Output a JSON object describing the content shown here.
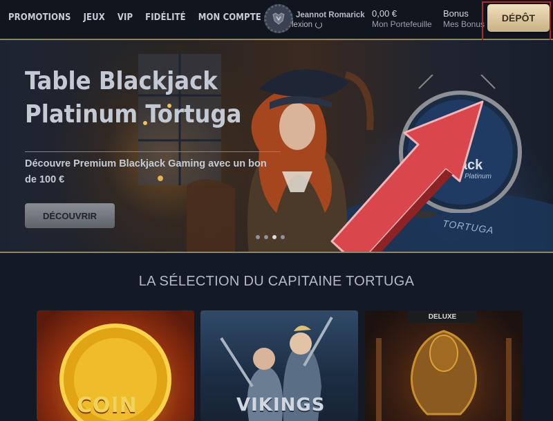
{
  "nav": {
    "items": [
      "PROMOTIONS",
      "JEUX",
      "VIP",
      "FIDÉLITÉ",
      "MON COMPTE"
    ]
  },
  "user": {
    "name": "Jeannot Romarick",
    "logout_label": "lexion",
    "avatar_icon": "crest-icon",
    "logout_icon": "power-icon"
  },
  "wallet": {
    "amount": "0,00 €",
    "label": "Mon Portefeuille"
  },
  "bonus": {
    "title": "Bonus",
    "label": "Mes Bonus"
  },
  "deposit": {
    "label": "DÉPÔT"
  },
  "hero": {
    "title": "Table Blackjack Platinum Tortuga",
    "subtitle": "Découvre Premium Blackjack Gaming avec un bon de 100 €",
    "cta": "DÉCOUVRIR",
    "badge_title": "Blackjack",
    "badge_sub": "Platinum",
    "table_text": "TORTUGA",
    "slides_total": 4,
    "active_slide": 2
  },
  "selection": {
    "title": "LA SÉLECTION DU CAPITAINE TORTUGA",
    "games": [
      {
        "name": "COIN"
      },
      {
        "name": "VIKINGS"
      },
      {
        "badge": "DELUXE"
      }
    ]
  },
  "colors": {
    "accent_gold": "#8f8464",
    "deposit_bg": "#e8d6b0",
    "highlight_red": "#b3282c",
    "arrow_red": "#d9464c"
  }
}
